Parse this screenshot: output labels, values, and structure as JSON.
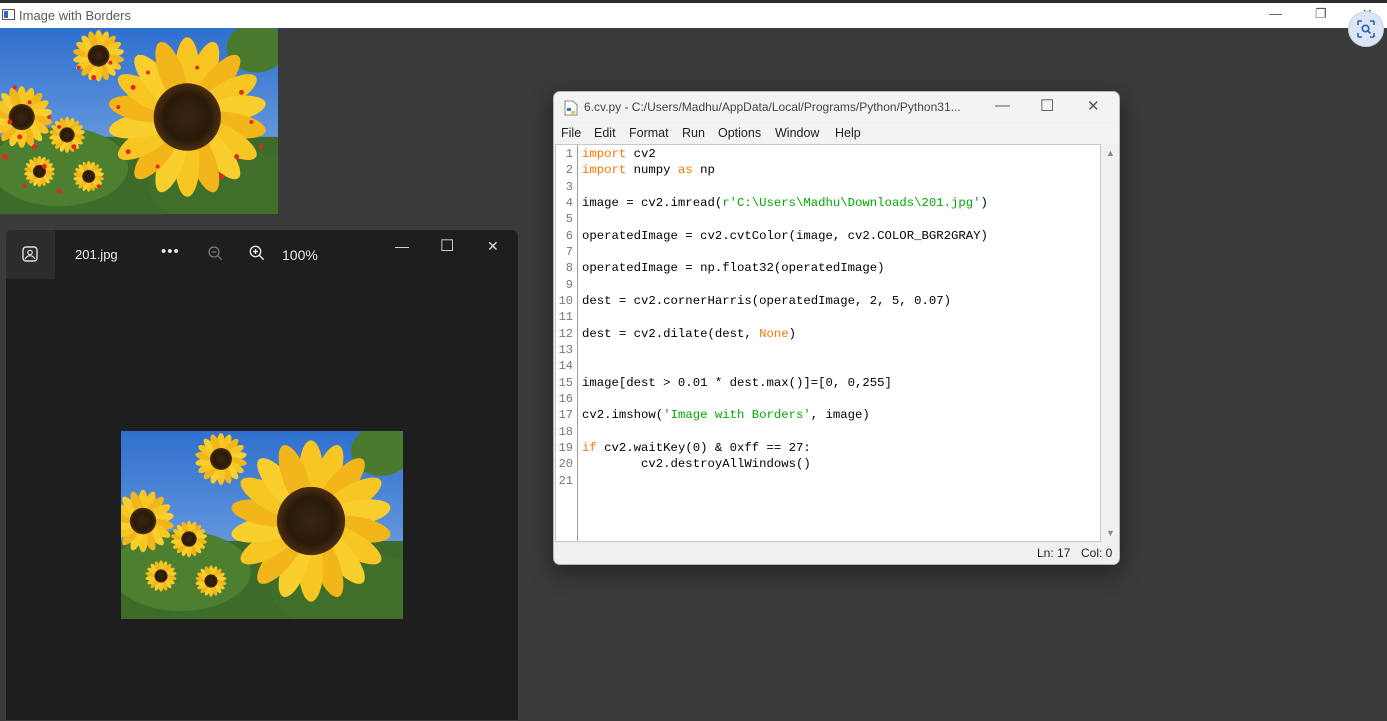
{
  "cv_window": {
    "title": "Image with Borders",
    "minimize_glyph": "—",
    "restore_glyph": "❐",
    "close_glyph": "✕"
  },
  "photos": {
    "filename": "201.jpg",
    "more_glyph": "•••",
    "zoom": "100%",
    "minimize_glyph": "—",
    "maximize_glyph": "☐",
    "close_glyph": "✕"
  },
  "idle": {
    "title": "6.cv.py - C:/Users/Madhu/AppData/Local/Programs/Python/Python31...",
    "minimize_glyph": "—",
    "maximize_glyph": "☐",
    "close_glyph": "✕",
    "menu": [
      "File",
      "Edit",
      "Format",
      "Run",
      "Options",
      "Window",
      "Help"
    ],
    "line_numbers": [
      "1",
      "2",
      "3",
      "4",
      "5",
      "6",
      "7",
      "8",
      "9",
      "10",
      "11",
      "12",
      "13",
      "14",
      "15",
      "16",
      "17",
      "18",
      "19",
      "20",
      "21"
    ],
    "code": {
      "l1_kw": "import",
      "l1_rest": " cv2",
      "l2_kw": "import",
      "l2_a": " numpy ",
      "l2_kw2": "as",
      "l2_b": " np",
      "l4_a": "image = cv2.imread(",
      "l4_str": "r'C:\\Users\\Madhu\\Downloads\\201.jpg'",
      "l4_b": ")",
      "l6": "operatedImage = cv2.cvtColor(image, cv2.COLOR_BGR2GRAY)",
      "l8": "operatedImage = np.float32(operatedImage)",
      "l10": "dest = cv2.cornerHarris(operatedImage, 2, 5, 0.07)",
      "l12_a": "dest = cv2.dilate(dest, ",
      "l12_kw": "None",
      "l12_b": ")",
      "l15": "image[dest > 0.01 * dest.max()]=[0, 0,255]",
      "l17_a": "cv2.imshow(",
      "l17_str": "'Image with Borders'",
      "l17_b": ", image)",
      "l19_kw": "if",
      "l19_rest": " cv2.waitKey(0) & 0xff == 27:",
      "l20": "        cv2.destroyAllWindows()"
    },
    "status_ln": "Ln: 17",
    "status_col": "Col: 0"
  },
  "icons": [
    "app-icon",
    "lens-icon",
    "gallery-icon",
    "zoom-out-icon",
    "zoom-in-icon",
    "python-file-icon",
    "scroll-up-icon",
    "scroll-down-icon"
  ]
}
